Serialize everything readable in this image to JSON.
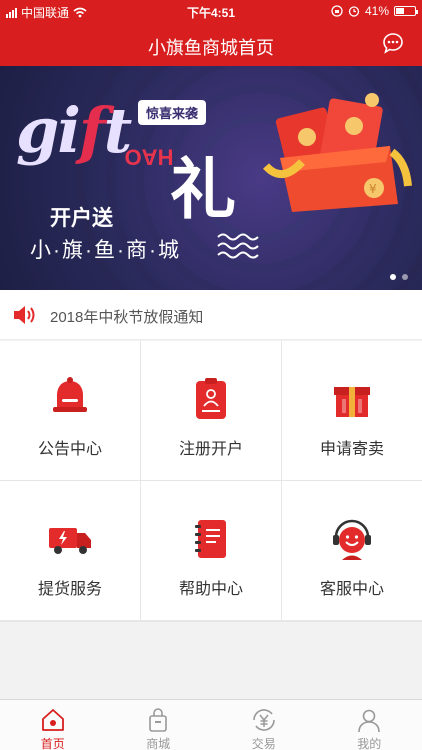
{
  "status_bar": {
    "carrier": "中国联通",
    "time": "下午4:51",
    "battery": "41%"
  },
  "nav": {
    "title": "小旗鱼商城首页"
  },
  "banner": {
    "gift_prefix": "gi",
    "gift_accent": "f",
    "gift_suffix": "t",
    "surprise_tag": "惊喜来袭",
    "hao": "HAO",
    "li": "礼",
    "open_gift": "开户送",
    "subtitle": "小·旗·鱼·商·城",
    "slide_count": 2,
    "active_slide": 1
  },
  "notice": {
    "text": "2018年中秋节放假通知"
  },
  "grid": {
    "items": [
      {
        "label": "公告中心",
        "icon": "bell-icon"
      },
      {
        "label": "注册开户",
        "icon": "register-card-icon"
      },
      {
        "label": "申请寄卖",
        "icon": "gift-box-icon"
      },
      {
        "label": "提货服务",
        "icon": "delivery-truck-icon"
      },
      {
        "label": "帮助中心",
        "icon": "notebook-icon"
      },
      {
        "label": "客服中心",
        "icon": "customer-service-icon"
      }
    ]
  },
  "tabs": [
    {
      "label": "首页",
      "icon": "home-icon",
      "active": true
    },
    {
      "label": "商城",
      "icon": "shopping-bag-icon",
      "active": false
    },
    {
      "label": "交易",
      "icon": "yuan-exchange-icon",
      "active": false
    },
    {
      "label": "我的",
      "icon": "user-icon",
      "active": false
    }
  ],
  "colors": {
    "brand_red": "#d81e1e",
    "banner_bg": "#2a2a5c",
    "tab_inactive": "#999999"
  }
}
